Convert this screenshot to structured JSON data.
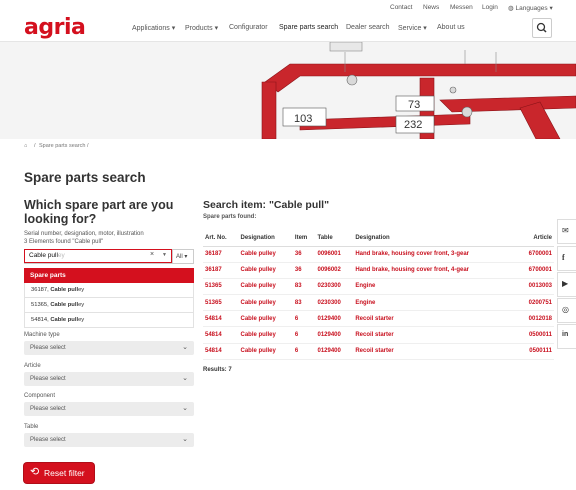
{
  "topbar": {
    "contact": "Contact",
    "news": "News",
    "messen": "Messen",
    "login": "Login",
    "languages": "Languages"
  },
  "brand": {
    "logo": "agria",
    "color": "#d4101e"
  },
  "nav": {
    "applications": "Applications",
    "products": "Products",
    "configurator": "Configurator",
    "spare_parts_search": "Spare parts search",
    "dealer_search": "Dealer search",
    "service": "Service",
    "about_us": "About us"
  },
  "hero": {
    "callouts": [
      "103",
      "73",
      "232"
    ]
  },
  "breadcrumb": {
    "current": "Spare parts search",
    "sep": "/"
  },
  "page_title": "Spare parts search",
  "left": {
    "question": "Which spare part are you looking for?",
    "hint": "Serial number, designation, motor, illustration",
    "found": "3 Elements found \"Cable pull\"",
    "search_value": "Cable pull",
    "search_suffix": "ey",
    "all_label": "All",
    "dropdown_header": "Spare parts",
    "suggestions": [
      {
        "num": "36187,",
        "name": "Cable pull",
        "rest": "ey"
      },
      {
        "num": "51365,",
        "name": "Cable pull",
        "rest": "ey"
      },
      {
        "num": "54814,",
        "name": "Cable pull",
        "rest": "ey"
      }
    ],
    "filters": [
      {
        "label": "Machine type",
        "placeholder": "Please select"
      },
      {
        "label": "Article",
        "placeholder": "Please select"
      },
      {
        "label": "Component",
        "placeholder": "Please select"
      },
      {
        "label": "Table",
        "placeholder": "Please select"
      }
    ],
    "reset_label": "Reset filter"
  },
  "results": {
    "title": "Search item: \"Cable pull\"",
    "subtitle": "Spare parts found:",
    "columns": [
      "Art. No.",
      "Designation",
      "Item",
      "Table",
      "Designation",
      "Article"
    ],
    "rows": [
      [
        "36187",
        "Cable pulley",
        "36",
        "0096001",
        "Hand brake, housing cover front, 3-gear",
        "6700001"
      ],
      [
        "36187",
        "Cable pulley",
        "36",
        "0096002",
        "Hand brake, housing cover front, 4-gear",
        "6700001"
      ],
      [
        "51365",
        "Cable pulley",
        "83",
        "0230300",
        "Engine",
        "0013003"
      ],
      [
        "51365",
        "Cable pulley",
        "83",
        "0230300",
        "Engine",
        "0200751"
      ],
      [
        "54814",
        "Cable pulley",
        "6",
        "0129400",
        "Recoil starter",
        "0012018"
      ],
      [
        "54814",
        "Cable pulley",
        "6",
        "0129400",
        "Recoil starter",
        "0500011"
      ],
      [
        "54814",
        "Cable pulley",
        "6",
        "0129400",
        "Recoil starter",
        "0500111"
      ]
    ],
    "count": "Results: 7"
  },
  "social_icons": [
    "mail-icon",
    "facebook-icon",
    "youtube-icon",
    "instagram-icon",
    "linkedin-icon"
  ]
}
